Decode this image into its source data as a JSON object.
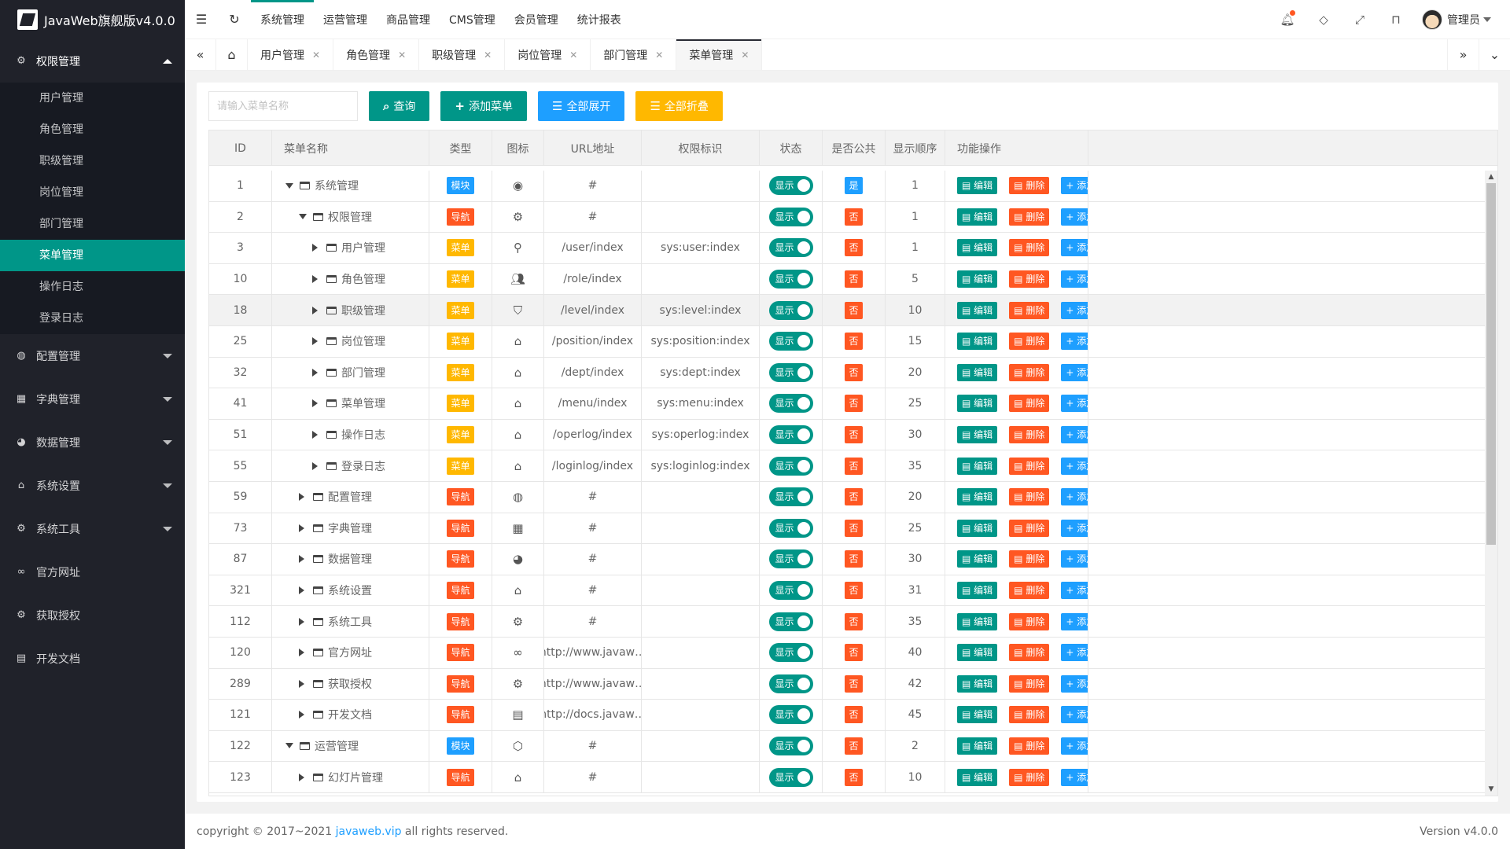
{
  "app": {
    "title": "JavaWeb旗舰版v4.0.0"
  },
  "sidebar": {
    "groups": [
      {
        "label": "权限管理",
        "icon": "gear-icon",
        "open": true,
        "items": [
          "用户管理",
          "角色管理",
          "职级管理",
          "岗位管理",
          "部门管理",
          "菜单管理",
          "操作日志",
          "登录日志"
        ]
      },
      {
        "label": "配置管理",
        "icon": "globe-icon"
      },
      {
        "label": "字典管理",
        "icon": "apps-icon"
      },
      {
        "label": "数据管理",
        "icon": "palette-icon"
      },
      {
        "label": "系统设置",
        "icon": "home-icon"
      },
      {
        "label": "系统工具",
        "icon": "gear-icon"
      },
      {
        "label": "官方网址",
        "icon": "link-icon"
      },
      {
        "label": "获取授权",
        "icon": "gear-icon"
      },
      {
        "label": "开发文档",
        "icon": "book-icon"
      }
    ],
    "active_item": "菜单管理"
  },
  "topbar": {
    "menus": [
      "系统管理",
      "运营管理",
      "商品管理",
      "CMS管理",
      "会员管理",
      "统计报表"
    ],
    "active_menu": "系统管理",
    "user": "管理员"
  },
  "tabs": [
    {
      "label": "用户管理"
    },
    {
      "label": "角色管理"
    },
    {
      "label": "职级管理"
    },
    {
      "label": "岗位管理"
    },
    {
      "label": "部门管理"
    },
    {
      "label": "菜单管理",
      "active": true
    }
  ],
  "toolbar": {
    "search_placeholder": "请输入菜单名称",
    "query_label": "查询",
    "add_label": "添加菜单",
    "expand_label": "全部展开",
    "collapse_label": "全部折叠"
  },
  "table": {
    "headers": [
      "ID",
      "菜单名称",
      "类型",
      "图标",
      "URL地址",
      "权限标识",
      "状态",
      "是否公共",
      "显示顺序",
      "功能操作"
    ],
    "status_label": "显示",
    "op_labels": {
      "edit": "编辑",
      "delete": "删除",
      "add": "添加"
    },
    "rows": [
      {
        "id": "1",
        "name": "系统管理",
        "level": 0,
        "expanded": true,
        "type": "模块",
        "icon": "chrome-icon",
        "url": "#",
        "perm": "",
        "public": "是",
        "order": "1"
      },
      {
        "id": "2",
        "name": "权限管理",
        "level": 1,
        "expanded": true,
        "type": "导航",
        "icon": "gear-icon",
        "url": "#",
        "perm": "",
        "public": "否",
        "order": "1"
      },
      {
        "id": "3",
        "name": "用户管理",
        "level": 2,
        "expanded": false,
        "type": "菜单",
        "icon": "user-icon",
        "url": "/user/index",
        "perm": "sys:user:index",
        "public": "否",
        "order": "1"
      },
      {
        "id": "10",
        "name": "角色管理",
        "level": 2,
        "expanded": false,
        "type": "菜单",
        "icon": "users-icon",
        "url": "/role/index",
        "perm": "",
        "public": "否",
        "order": "5"
      },
      {
        "id": "18",
        "name": "职级管理",
        "level": 2,
        "expanded": false,
        "type": "菜单",
        "icon": "shield-icon",
        "url": "/level/index",
        "perm": "sys:level:index",
        "public": "否",
        "order": "10"
      },
      {
        "id": "25",
        "name": "岗位管理",
        "level": 2,
        "expanded": false,
        "type": "菜单",
        "icon": "home-icon",
        "url": "/position/index",
        "perm": "sys:position:index",
        "public": "否",
        "order": "15"
      },
      {
        "id": "32",
        "name": "部门管理",
        "level": 2,
        "expanded": false,
        "type": "菜单",
        "icon": "home-icon",
        "url": "/dept/index",
        "perm": "sys:dept:index",
        "public": "否",
        "order": "20"
      },
      {
        "id": "41",
        "name": "菜单管理",
        "level": 2,
        "expanded": false,
        "type": "菜单",
        "icon": "home-icon",
        "url": "/menu/index",
        "perm": "sys:menu:index",
        "public": "否",
        "order": "25"
      },
      {
        "id": "51",
        "name": "操作日志",
        "level": 2,
        "expanded": false,
        "type": "菜单",
        "icon": "home-icon",
        "url": "/operlog/index",
        "perm": "sys:operlog:index",
        "public": "否",
        "order": "30"
      },
      {
        "id": "55",
        "name": "登录日志",
        "level": 2,
        "expanded": false,
        "type": "菜单",
        "icon": "home-icon",
        "url": "/loginlog/index",
        "perm": "sys:loginlog:index",
        "public": "否",
        "order": "35"
      },
      {
        "id": "59",
        "name": "配置管理",
        "level": 1,
        "expanded": false,
        "type": "导航",
        "icon": "globe-icon",
        "url": "#",
        "perm": "",
        "public": "否",
        "order": "20"
      },
      {
        "id": "73",
        "name": "字典管理",
        "level": 1,
        "expanded": false,
        "type": "导航",
        "icon": "apps-icon",
        "url": "#",
        "perm": "",
        "public": "否",
        "order": "25"
      },
      {
        "id": "87",
        "name": "数据管理",
        "level": 1,
        "expanded": false,
        "type": "导航",
        "icon": "palette-icon",
        "url": "#",
        "perm": "",
        "public": "否",
        "order": "30"
      },
      {
        "id": "321",
        "name": "系统设置",
        "level": 1,
        "expanded": false,
        "type": "导航",
        "icon": "home-icon",
        "url": "#",
        "perm": "",
        "public": "否",
        "order": "31"
      },
      {
        "id": "112",
        "name": "系统工具",
        "level": 1,
        "expanded": false,
        "type": "导航",
        "icon": "gear-icon",
        "url": "#",
        "perm": "",
        "public": "否",
        "order": "35"
      },
      {
        "id": "120",
        "name": "官方网址",
        "level": 1,
        "expanded": false,
        "type": "导航",
        "icon": "link-icon",
        "url": "http://www.javaw…",
        "perm": "",
        "public": "否",
        "order": "40"
      },
      {
        "id": "289",
        "name": "获取授权",
        "level": 1,
        "expanded": false,
        "type": "导航",
        "icon": "gear-icon",
        "url": "http://www.javaw…",
        "perm": "",
        "public": "否",
        "order": "42"
      },
      {
        "id": "121",
        "name": "开发文档",
        "level": 1,
        "expanded": false,
        "type": "导航",
        "icon": "book-icon",
        "url": "http://docs.javaw…",
        "perm": "",
        "public": "否",
        "order": "45"
      },
      {
        "id": "122",
        "name": "运营管理",
        "level": 0,
        "expanded": true,
        "type": "模块",
        "icon": "cube-icon",
        "url": "#",
        "perm": "",
        "public": "否",
        "order": "2"
      },
      {
        "id": "123",
        "name": "幻灯片管理",
        "level": 1,
        "expanded": false,
        "type": "导航",
        "icon": "home-icon",
        "url": "#",
        "perm": "",
        "public": "否",
        "order": "10"
      }
    ]
  },
  "footer": {
    "copyright_prefix": "copyright © 2017~2021",
    "link": "javaweb.vip",
    "suffix": "all rights reserved.",
    "version": "Version v4.0.0"
  },
  "colors": {
    "accent": "#009688",
    "sidebar_bg": "#20222a",
    "blue": "#1e9fff",
    "orange": "#ffb800",
    "red": "#ff5722"
  }
}
